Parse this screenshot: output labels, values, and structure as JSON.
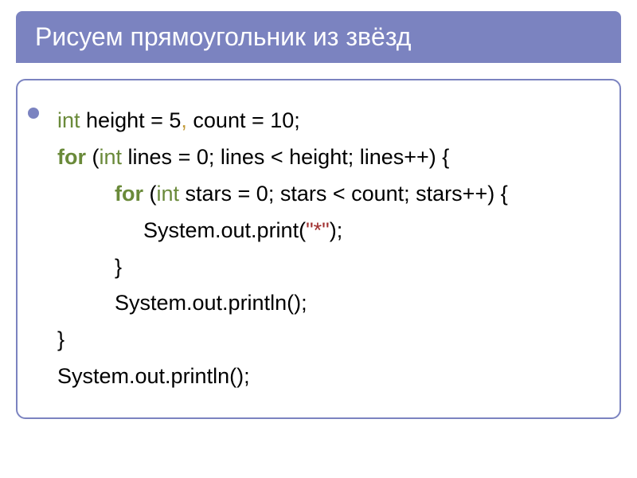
{
  "slide": {
    "title": "Рисуем прямоугольник из звёзд",
    "code": {
      "line1": {
        "int1": "int",
        "t1": " height = 5",
        "comma": ",",
        "t2": " count = 10;"
      },
      "line2": {
        "for": "for",
        "t1": " (",
        "int": "int",
        "t2": " lines = 0; lines < height; lines++) {"
      },
      "line3": {
        "for": "for",
        "t1": " (",
        "int": "int",
        "t2": " stars = 0; stars < count; stars++) {"
      },
      "line4": {
        "t1": "System.out.print(",
        "str": "\"*\"",
        "t2": ");"
      },
      "line5": {
        "t1": "}"
      },
      "line6": {
        "t1": "System.out.println();"
      },
      "line7": {
        "t1": "}"
      },
      "line8": {
        "t1": "System.out.println();"
      }
    }
  }
}
